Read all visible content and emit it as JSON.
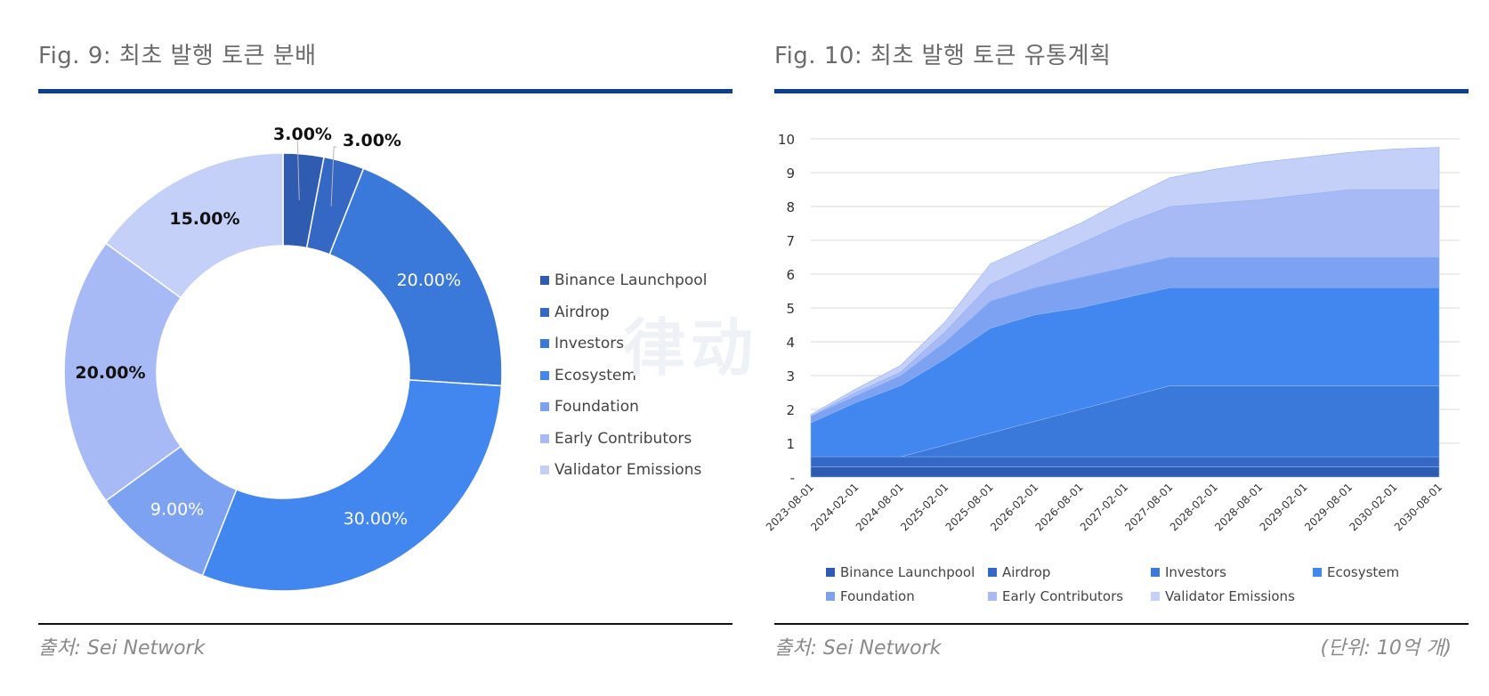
{
  "left": {
    "title": "Fig. 9: 최초 발행 토큰 분배",
    "source": "출처: Sei Network"
  },
  "right": {
    "title": "Fig. 10: 최초 발행 토큰 유통계획",
    "source": "출처: Sei Network",
    "unit": "(단위: 10억 개)"
  },
  "colors": {
    "title_rule": "#0d3f8f",
    "series": [
      "#2f5bb0",
      "#3567c4",
      "#3a78d9",
      "#4286f0",
      "#7ea2f2",
      "#a7baf6",
      "#c5d0f8"
    ]
  },
  "chart_data": [
    {
      "type": "pie",
      "donut": true,
      "title": "Fig. 9: 최초 발행 토큰 분배",
      "categories": [
        "Binance Launchpool",
        "Airdrop",
        "Investors",
        "Ecosystem",
        "Foundation",
        "Early Contributors",
        "Validator Emissions"
      ],
      "values": [
        3,
        3,
        20,
        30,
        9,
        20,
        15
      ],
      "labels": [
        "3.00%",
        "3.00%",
        "20.00%",
        "30.00%",
        "9.00%",
        "20.00%",
        "15.00%"
      ],
      "legend_position": "right"
    },
    {
      "type": "area",
      "stacked": true,
      "title": "Fig. 10: 최초 발행 토큰 유통계획",
      "xlabel": "",
      "ylabel": "",
      "unit": "(단위: 10억 개)",
      "ylim": [
        0,
        10
      ],
      "yticks": [
        "-",
        "1",
        "2",
        "3",
        "4",
        "5",
        "6",
        "7",
        "8",
        "9",
        "10"
      ],
      "grid": true,
      "legend_position": "bottom",
      "x": [
        "2023-08-01",
        "2024-02-01",
        "2024-08-01",
        "2025-02-01",
        "2025-08-01",
        "2026-02-01",
        "2026-08-01",
        "2027-02-01",
        "2027-08-01",
        "2028-02-01",
        "2028-08-01",
        "2029-02-01",
        "2029-08-01",
        "2030-02-01",
        "2030-08-01"
      ],
      "series": [
        {
          "name": "Binance Launchpool",
          "values": [
            0.3,
            0.3,
            0.3,
            0.3,
            0.3,
            0.3,
            0.3,
            0.3,
            0.3,
            0.3,
            0.3,
            0.3,
            0.3,
            0.3,
            0.3
          ]
        },
        {
          "name": "Airdrop",
          "values": [
            0.3,
            0.3,
            0.3,
            0.3,
            0.3,
            0.3,
            0.3,
            0.3,
            0.3,
            0.3,
            0.3,
            0.3,
            0.3,
            0.3,
            0.3
          ]
        },
        {
          "name": "Investors",
          "values": [
            0,
            0,
            0,
            0.35,
            0.7,
            1.05,
            1.4,
            1.75,
            2.1,
            2.1,
            2.1,
            2.1,
            2.1,
            2.1,
            2.1
          ]
        },
        {
          "name": "Ecosystem",
          "values": [
            1.0,
            1.6,
            2.1,
            2.55,
            3.1,
            3.15,
            3.0,
            2.95,
            2.9,
            2.9,
            2.9,
            2.9,
            2.9,
            2.9,
            2.9
          ]
        },
        {
          "name": "Foundation",
          "values": [
            0.2,
            0.2,
            0.3,
            0.5,
            0.8,
            0.8,
            0.9,
            0.9,
            0.9,
            0.9,
            0.9,
            0.9,
            0.9,
            0.9,
            0.9
          ]
        },
        {
          "name": "Early Contributors",
          "values": [
            0.0,
            0.1,
            0.1,
            0.3,
            0.5,
            0.7,
            1.0,
            1.3,
            1.5,
            1.6,
            1.7,
            1.85,
            2.0,
            2.0,
            2.0
          ]
        },
        {
          "name": "Validator Emissions",
          "values": [
            0.05,
            0.1,
            0.2,
            0.3,
            0.6,
            0.6,
            0.6,
            0.7,
            0.85,
            1.0,
            1.1,
            1.1,
            1.1,
            1.2,
            1.25
          ]
        }
      ]
    }
  ],
  "watermark": "律动"
}
